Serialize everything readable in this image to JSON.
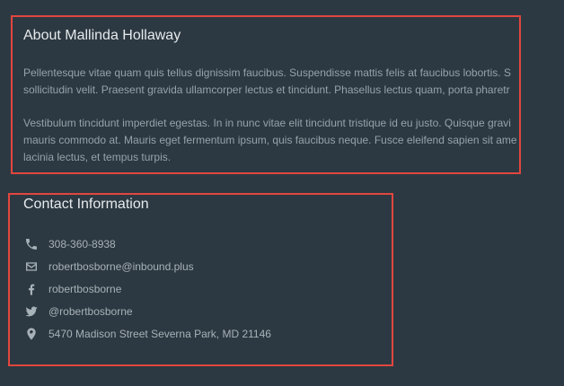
{
  "about": {
    "title": "About Mallinda Hollaway",
    "paragraph_1_line_1": "Pellentesque vitae quam quis tellus dignissim faucibus. Suspendisse mattis felis at faucibus lobortis. S",
    "paragraph_1_line_2": "sollicitudin velit. Praesent gravida ullamcorper lectus et tincidunt. Phasellus lectus quam, porta pharetr",
    "paragraph_2_line_1": "Vestibulum tincidunt imperdiet egestas. In in nunc vitae elit tincidunt tristique id eu justo. Quisque gravi",
    "paragraph_2_line_2": "mauris commodo at. Mauris eget fermentum ipsum, quis faucibus neque. Fusce eleifend sapien sit ame",
    "paragraph_2_line_3": "lacinia lectus, et tempus turpis."
  },
  "contact": {
    "title": "Contact Information",
    "items": [
      {
        "icon": "phone-icon",
        "label": "308-360-8938"
      },
      {
        "icon": "email-icon",
        "label": "robertbosborne@inbound.plus"
      },
      {
        "icon": "facebook-icon",
        "label": "robertbosborne"
      },
      {
        "icon": "twitter-icon",
        "label": "@robertbosborne"
      },
      {
        "icon": "location-icon",
        "label": "5470 Madison Street Severna Park, MD 21146"
      }
    ]
  },
  "colors": {
    "background": "#2d3942",
    "highlight": "#e2463f",
    "heading": "#e6eaed",
    "body_text": "#96a2aa",
    "contact_text": "#a7b1b8"
  }
}
